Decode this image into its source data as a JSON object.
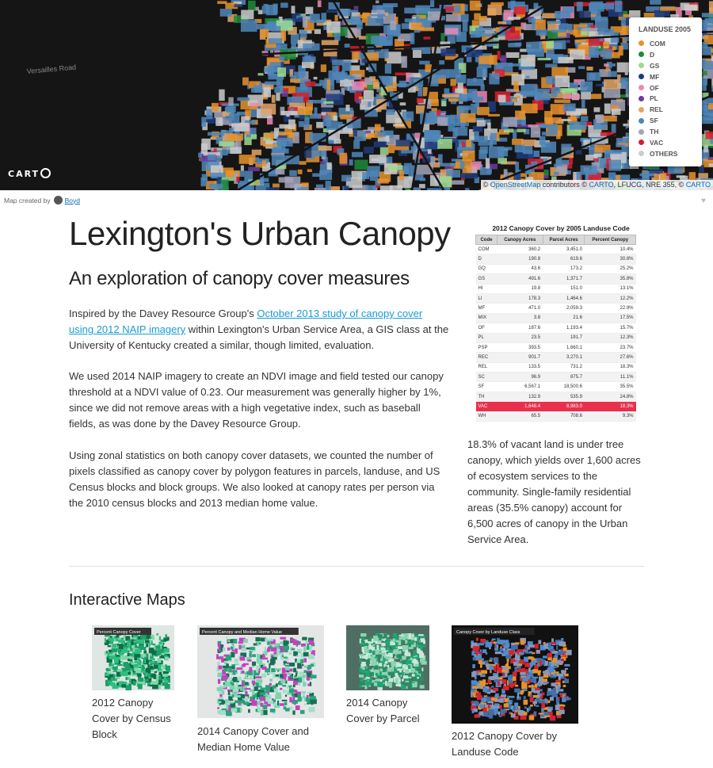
{
  "map": {
    "road_label": "Versailles Road",
    "logo": "CART",
    "attribution": {
      "prefix": "©",
      "osm_link": "OpenStreetMap",
      "middle": "contributors ©",
      "carto_link": "CARTO",
      "sources": ", LFUCG, NRE 355, ©",
      "carto_link2": "CARTO"
    },
    "legend": {
      "title": "LANDUSE 2005",
      "items": [
        {
          "label": "COM",
          "color": "#e8922b"
        },
        {
          "label": "D",
          "color": "#1e8a3a"
        },
        {
          "label": "GS",
          "color": "#9ed98f"
        },
        {
          "label": "MF",
          "color": "#1f3b7a"
        },
        {
          "label": "OF",
          "color": "#e98ab3"
        },
        {
          "label": "PL",
          "color": "#6a3d9a"
        },
        {
          "label": "REL",
          "color": "#e3a466"
        },
        {
          "label": "SF",
          "color": "#4f86b8"
        },
        {
          "label": "TH",
          "color": "#a3a3b8"
        },
        {
          "label": "VAC",
          "color": "#d81e2e"
        },
        {
          "label": "OTHERS",
          "color": "#cccccc"
        }
      ]
    }
  },
  "credit": {
    "prefix": "Map created by",
    "author": "Boyd"
  },
  "title": "Lexington's Urban Canopy",
  "subtitle": "An exploration of canopy cover measures",
  "intro": {
    "before": "Inspired by the Davey Resource Group's ",
    "link": "October 2013 study of canopy cover using 2012 NAIP imagery",
    "after": " within Lexington's Urban Service Area, a GIS class at the University of Kentucky created a similar, though limited, evaluation."
  },
  "para2": "We used 2014 NAIP imagery to create an NDVI image and field tested our canopy threshold at a NDVI value of 0.23. Our measurement was generally higher by 1%, since we did not remove areas with a high vegetative index, such as baseball fields, as was done by the Davey Resource Group.",
  "para3": "Using zonal statistics on both canopy cover datasets, we counted the number of pixels classified as canopy cover by polygon features in parcels, landuse, and US Census blocks and block groups. We also looked at canopy rates per person via the 2010 census blocks and 2013 median home value.",
  "canopy_table": {
    "title": "2012 Canopy Cover by 2005 Landuse Code",
    "headers": [
      "Code",
      "Canopy Acres",
      "Parcel Acres",
      "Percent Canopy"
    ],
    "rows": [
      [
        "COM",
        "360.2",
        "3,451.0",
        "10.4%"
      ],
      [
        "D",
        "190.8",
        "619.6",
        "30.8%"
      ],
      [
        "GQ",
        "43.6",
        "173.2",
        "25.2%"
      ],
      [
        "GS",
        "491.6",
        "1,371.7",
        "35.8%"
      ],
      [
        "HI",
        "19.8",
        "151.0",
        "13.1%"
      ],
      [
        "LI",
        "178.3",
        "1,464.6",
        "12.2%"
      ],
      [
        "MF",
        "471.0",
        "2,059.3",
        "22.9%"
      ],
      [
        "MIX",
        "3.8",
        "21.6",
        "17.5%"
      ],
      [
        "OF",
        "187.6",
        "1,193.4",
        "15.7%"
      ],
      [
        "PL",
        "23.5",
        "191.7",
        "12.3%"
      ],
      [
        "PSP",
        "393.5",
        "1,660.1",
        "23.7%"
      ],
      [
        "REC",
        "901.7",
        "3,270.1",
        "27.6%"
      ],
      [
        "REL",
        "133.5",
        "731.2",
        "18.3%"
      ],
      [
        "SC",
        "96.9",
        "875.7",
        "11.1%"
      ],
      [
        "SF",
        "6,567.1",
        "18,500.6",
        "35.5%"
      ],
      [
        "TH",
        "132.9",
        "535.9",
        "24.8%"
      ],
      [
        "VAC",
        "1,648.4",
        "8,983.0",
        "18.3%"
      ],
      [
        "WH",
        "65.5",
        "708.6",
        "9.3%"
      ]
    ],
    "highlight_row": "VAC"
  },
  "side_note": "18.3% of vacant land is under tree canopy, which yields over 1,600 acres of ecosystem services to the community. Single-family residential areas (35.5% canopy) account for 6,500 acres of canopy in the Urban Service Area.",
  "interactive": {
    "heading": "Interactive Maps",
    "maps": [
      {
        "title": "2012 Canopy Cover by Census Block",
        "thumb_label": "Percent Canopy Cover"
      },
      {
        "title": "2014 Canopy Cover and Median Home Value",
        "thumb_label": "Percent Canopy and Median Home Value"
      },
      {
        "title": "2014 Canopy Cover by Parcel",
        "thumb_label": ""
      },
      {
        "title": "2012 Canopy Cover by Landuse Code",
        "thumb_label": "Canopy Cover by Landuse Class"
      }
    ]
  }
}
